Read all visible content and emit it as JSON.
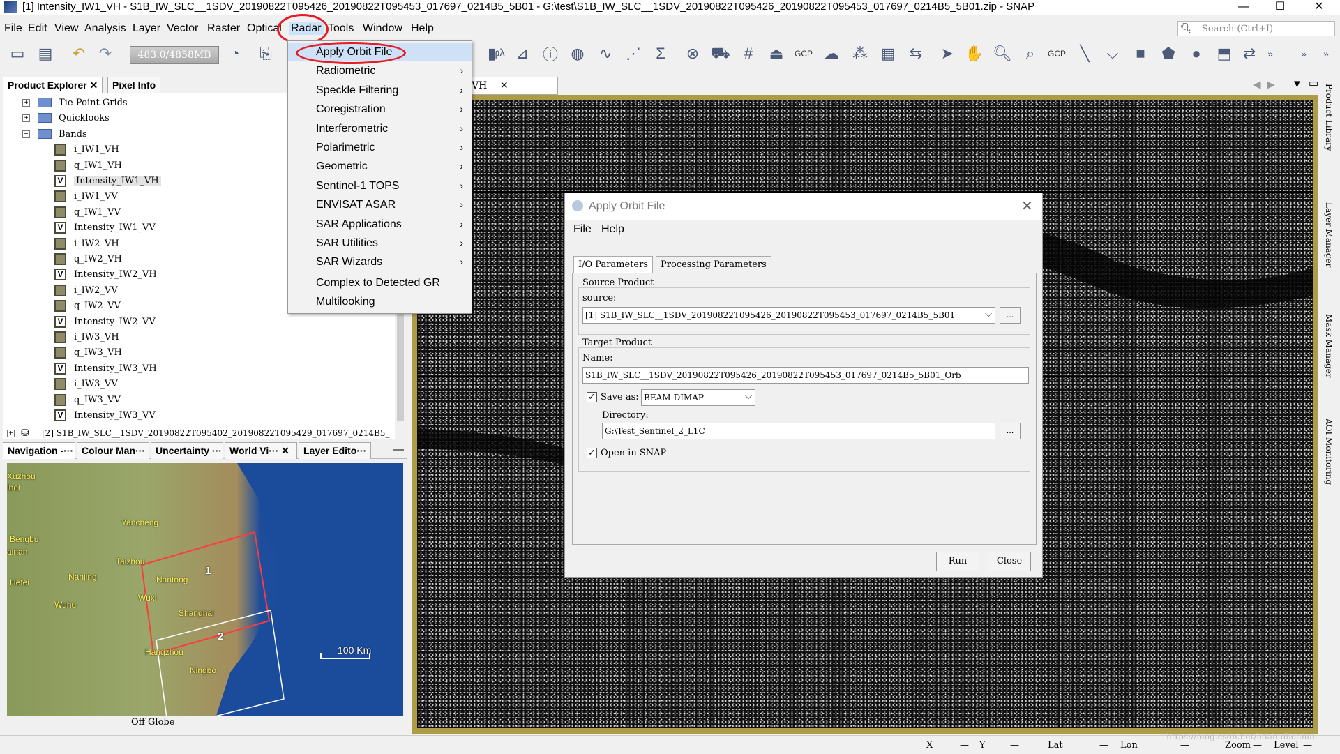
{
  "window": {
    "title": "[1] Intensity_IW1_VH - S1B_IW_SLC__1SDV_20190822T095426_20190822T095453_017697_0214B5_5B01 - G:\\test\\S1B_IW_SLC__1SDV_20190822T095426_20190822T095453_017697_0214B5_5B01.zip - SNAP"
  },
  "menubar": {
    "items": [
      "File",
      "Edit",
      "View",
      "Analysis",
      "Layer",
      "Vector",
      "Raster",
      "Optical",
      "Radar",
      "Tools",
      "Window",
      "Help"
    ],
    "search_placeholder": "Search (Ctrl+I)"
  },
  "toolbar": {
    "memory": "483.0/4858MB",
    "gcp_label": "GCP"
  },
  "radar_menu": {
    "items": [
      {
        "label": "Apply Orbit File",
        "submenu": false
      },
      {
        "label": "Radiometric",
        "submenu": true
      },
      {
        "label": "Speckle Filtering",
        "submenu": true
      },
      {
        "label": "Coregistration",
        "submenu": true
      },
      {
        "label": "Interferometric",
        "submenu": true
      },
      {
        "label": "Polarimetric",
        "submenu": true
      },
      {
        "label": "Geometric",
        "submenu": true
      },
      {
        "label": "Sentinel-1 TOPS",
        "submenu": true
      },
      {
        "label": "ENVISAT ASAR",
        "submenu": true
      },
      {
        "label": "SAR Applications",
        "submenu": true
      },
      {
        "label": "SAR Utilities",
        "submenu": true
      },
      {
        "label": "SAR Wizards",
        "submenu": true
      },
      {
        "label": "Complex to Detected GR",
        "submenu": false
      },
      {
        "label": "Multilooking",
        "submenu": false
      }
    ]
  },
  "product_explorer": {
    "tabs": [
      "Product Explorer",
      "Pixel Info"
    ],
    "nodes": [
      {
        "label": "Tie-Point Grids",
        "kind": "folder"
      },
      {
        "label": "Quicklooks",
        "kind": "folder"
      },
      {
        "label": "Bands",
        "kind": "folder"
      },
      {
        "label": "i_IW1_VH",
        "kind": "band"
      },
      {
        "label": "q_IW1_VH",
        "kind": "band"
      },
      {
        "label": "Intensity_IW1_VH",
        "kind": "vband"
      },
      {
        "label": "i_IW1_VV",
        "kind": "band"
      },
      {
        "label": "q_IW1_VV",
        "kind": "band"
      },
      {
        "label": "Intensity_IW1_VV",
        "kind": "vband"
      },
      {
        "label": "i_IW2_VH",
        "kind": "band"
      },
      {
        "label": "q_IW2_VH",
        "kind": "band"
      },
      {
        "label": "Intensity_IW2_VH",
        "kind": "vband"
      },
      {
        "label": "i_IW2_VV",
        "kind": "band"
      },
      {
        "label": "q_IW2_VV",
        "kind": "band"
      },
      {
        "label": "Intensity_IW2_VV",
        "kind": "vband"
      },
      {
        "label": "i_IW3_VH",
        "kind": "band"
      },
      {
        "label": "q_IW3_VH",
        "kind": "band"
      },
      {
        "label": "Intensity_IW3_VH",
        "kind": "vband"
      },
      {
        "label": "i_IW3_VV",
        "kind": "band"
      },
      {
        "label": "q_IW3_VV",
        "kind": "band"
      },
      {
        "label": "Intensity_IW3_VV",
        "kind": "vband"
      }
    ],
    "product2": "[2]  S1B_IW_SLC__1SDV_20190822T095402_20190822T095429_017697_0214B5_"
  },
  "nav_panel": {
    "tabs": [
      "Navigation -···",
      "Colour Man···",
      "Uncertainty ···",
      "World Vi···",
      "Layer Edito···"
    ],
    "map_labels": [
      "Xuzhou",
      "lbei",
      "Yancheng",
      "Bengbu",
      "ainan",
      "Taizhou",
      "Nanjing",
      "Nantong",
      "Hefei",
      "Wuxi",
      "Wuhu",
      "Shanghai",
      "Hangzhou",
      "Ningbo",
      "1",
      "2"
    ],
    "scale": "100 Km",
    "footer": "Off Globe"
  },
  "image_view": {
    "tab": "nsity_IW1_VH"
  },
  "right_tabs": [
    "Product Library",
    "Layer Manager",
    "Mask Manager",
    "AOI Monitoring"
  ],
  "statusbar": {
    "labels": [
      "X",
      "Y",
      "Lat",
      "Lon",
      "Zoom",
      "Level"
    ],
    "dash": "—",
    "watermark": "https://blog.csdn.net/lidahuilidahui"
  },
  "dialog": {
    "title": "Apply Orbit File",
    "menu": [
      "File",
      "Help"
    ],
    "tabs": [
      "I/O Parameters",
      "Processing Parameters"
    ],
    "source_group": "Source Product",
    "source_label": "source:",
    "source_value": "[1] S1B_IW_SLC__1SDV_20190822T095426_20190822T095453_017697_0214B5_5B01",
    "target_group": "Target Product",
    "name_label": "Name:",
    "name_value": "S1B_IW_SLC__1SDV_20190822T095426_20190822T095453_017697_0214B5_5B01_Orb",
    "save_as_label": "Save as:",
    "save_as_value": "BEAM-DIMAP",
    "directory_label": "Directory:",
    "directory_value": "G:\\Test_Sentinel_2_L1C",
    "open_in_snap": "Open in SNAP",
    "dots": "...",
    "run": "Run",
    "close": "Close"
  },
  "colors": {
    "highlight_ellipse": "#e51c24",
    "image_border": "#ad9b46",
    "menu_hover": "#cfe1f7"
  }
}
